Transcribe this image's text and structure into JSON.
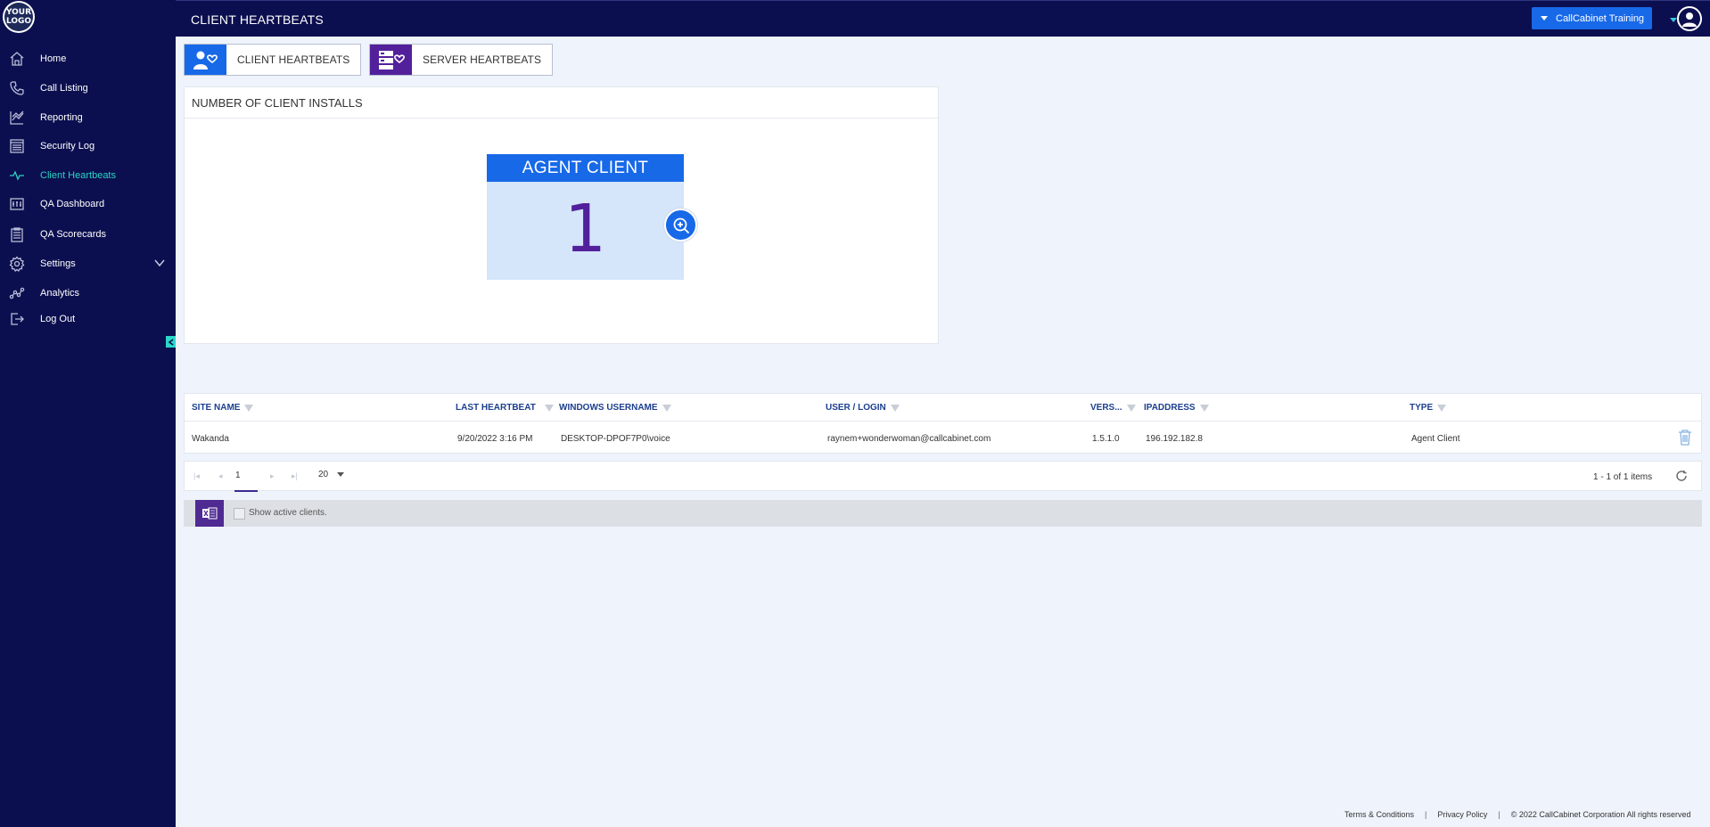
{
  "logo": {
    "text": "YOUR LOGO"
  },
  "header": {
    "title": "CLIENT HEARTBEATS",
    "tenant_label": "CallCabinet Training"
  },
  "sidebar": {
    "items": [
      {
        "label": "Home",
        "icon": "home-icon"
      },
      {
        "label": "Call Listing",
        "icon": "phone-icon"
      },
      {
        "label": "Reporting",
        "icon": "chart-icon"
      },
      {
        "label": "Security Log",
        "icon": "log-icon"
      },
      {
        "label": "Client Heartbeats",
        "icon": "heartbeat-icon",
        "active": true
      },
      {
        "label": "QA Dashboard",
        "icon": "dashboard-icon"
      },
      {
        "label": "QA Scorecards",
        "icon": "clipboard-icon"
      },
      {
        "label": "Settings",
        "icon": "gear-icon"
      },
      {
        "label": "Analytics",
        "icon": "analytics-icon"
      },
      {
        "label": "Log Out",
        "icon": "logout-icon"
      }
    ]
  },
  "tabs": [
    {
      "label": "CLIENT HEARTBEATS",
      "icon": "client-heartbeat-icon",
      "color": "#1769e8"
    },
    {
      "label": "SERVER HEARTBEATS",
      "icon": "server-heartbeat-icon",
      "color": "#53209b"
    }
  ],
  "installs_panel": {
    "title": "NUMBER OF CLIENT INSTALLS",
    "card": {
      "label": "AGENT CLIENT",
      "value": "1"
    }
  },
  "grid": {
    "columns": [
      "SITE NAME",
      "LAST HEARTBEAT",
      "WINDOWS USERNAME",
      "USER / LOGIN",
      "VERS...",
      "IPADDRESS",
      "TYPE"
    ],
    "rows": [
      [
        "Wakanda",
        "9/20/2022 3:16 PM",
        "DESKTOP-DPOF7P0\\voice",
        "raynem+wonderwoman@callcabinet.com",
        "1.5.1.0",
        "196.192.182.8",
        "Agent Client"
      ]
    ]
  },
  "pager": {
    "current_page": "1",
    "page_size": "20",
    "info": "1 - 1 of 1 items"
  },
  "toolbar": {
    "show_active_label": "Show active clients."
  },
  "footer": {
    "terms": "Terms & Conditions",
    "privacy": "Privacy Policy",
    "copyright": "© 2022 CallCabinet Corporation All rights reserved"
  },
  "colors": {
    "sidebar_bg": "#0c0f4f",
    "accent_blue": "#1769e8",
    "accent_purple": "#53209b",
    "active_teal": "#29d4c6"
  }
}
